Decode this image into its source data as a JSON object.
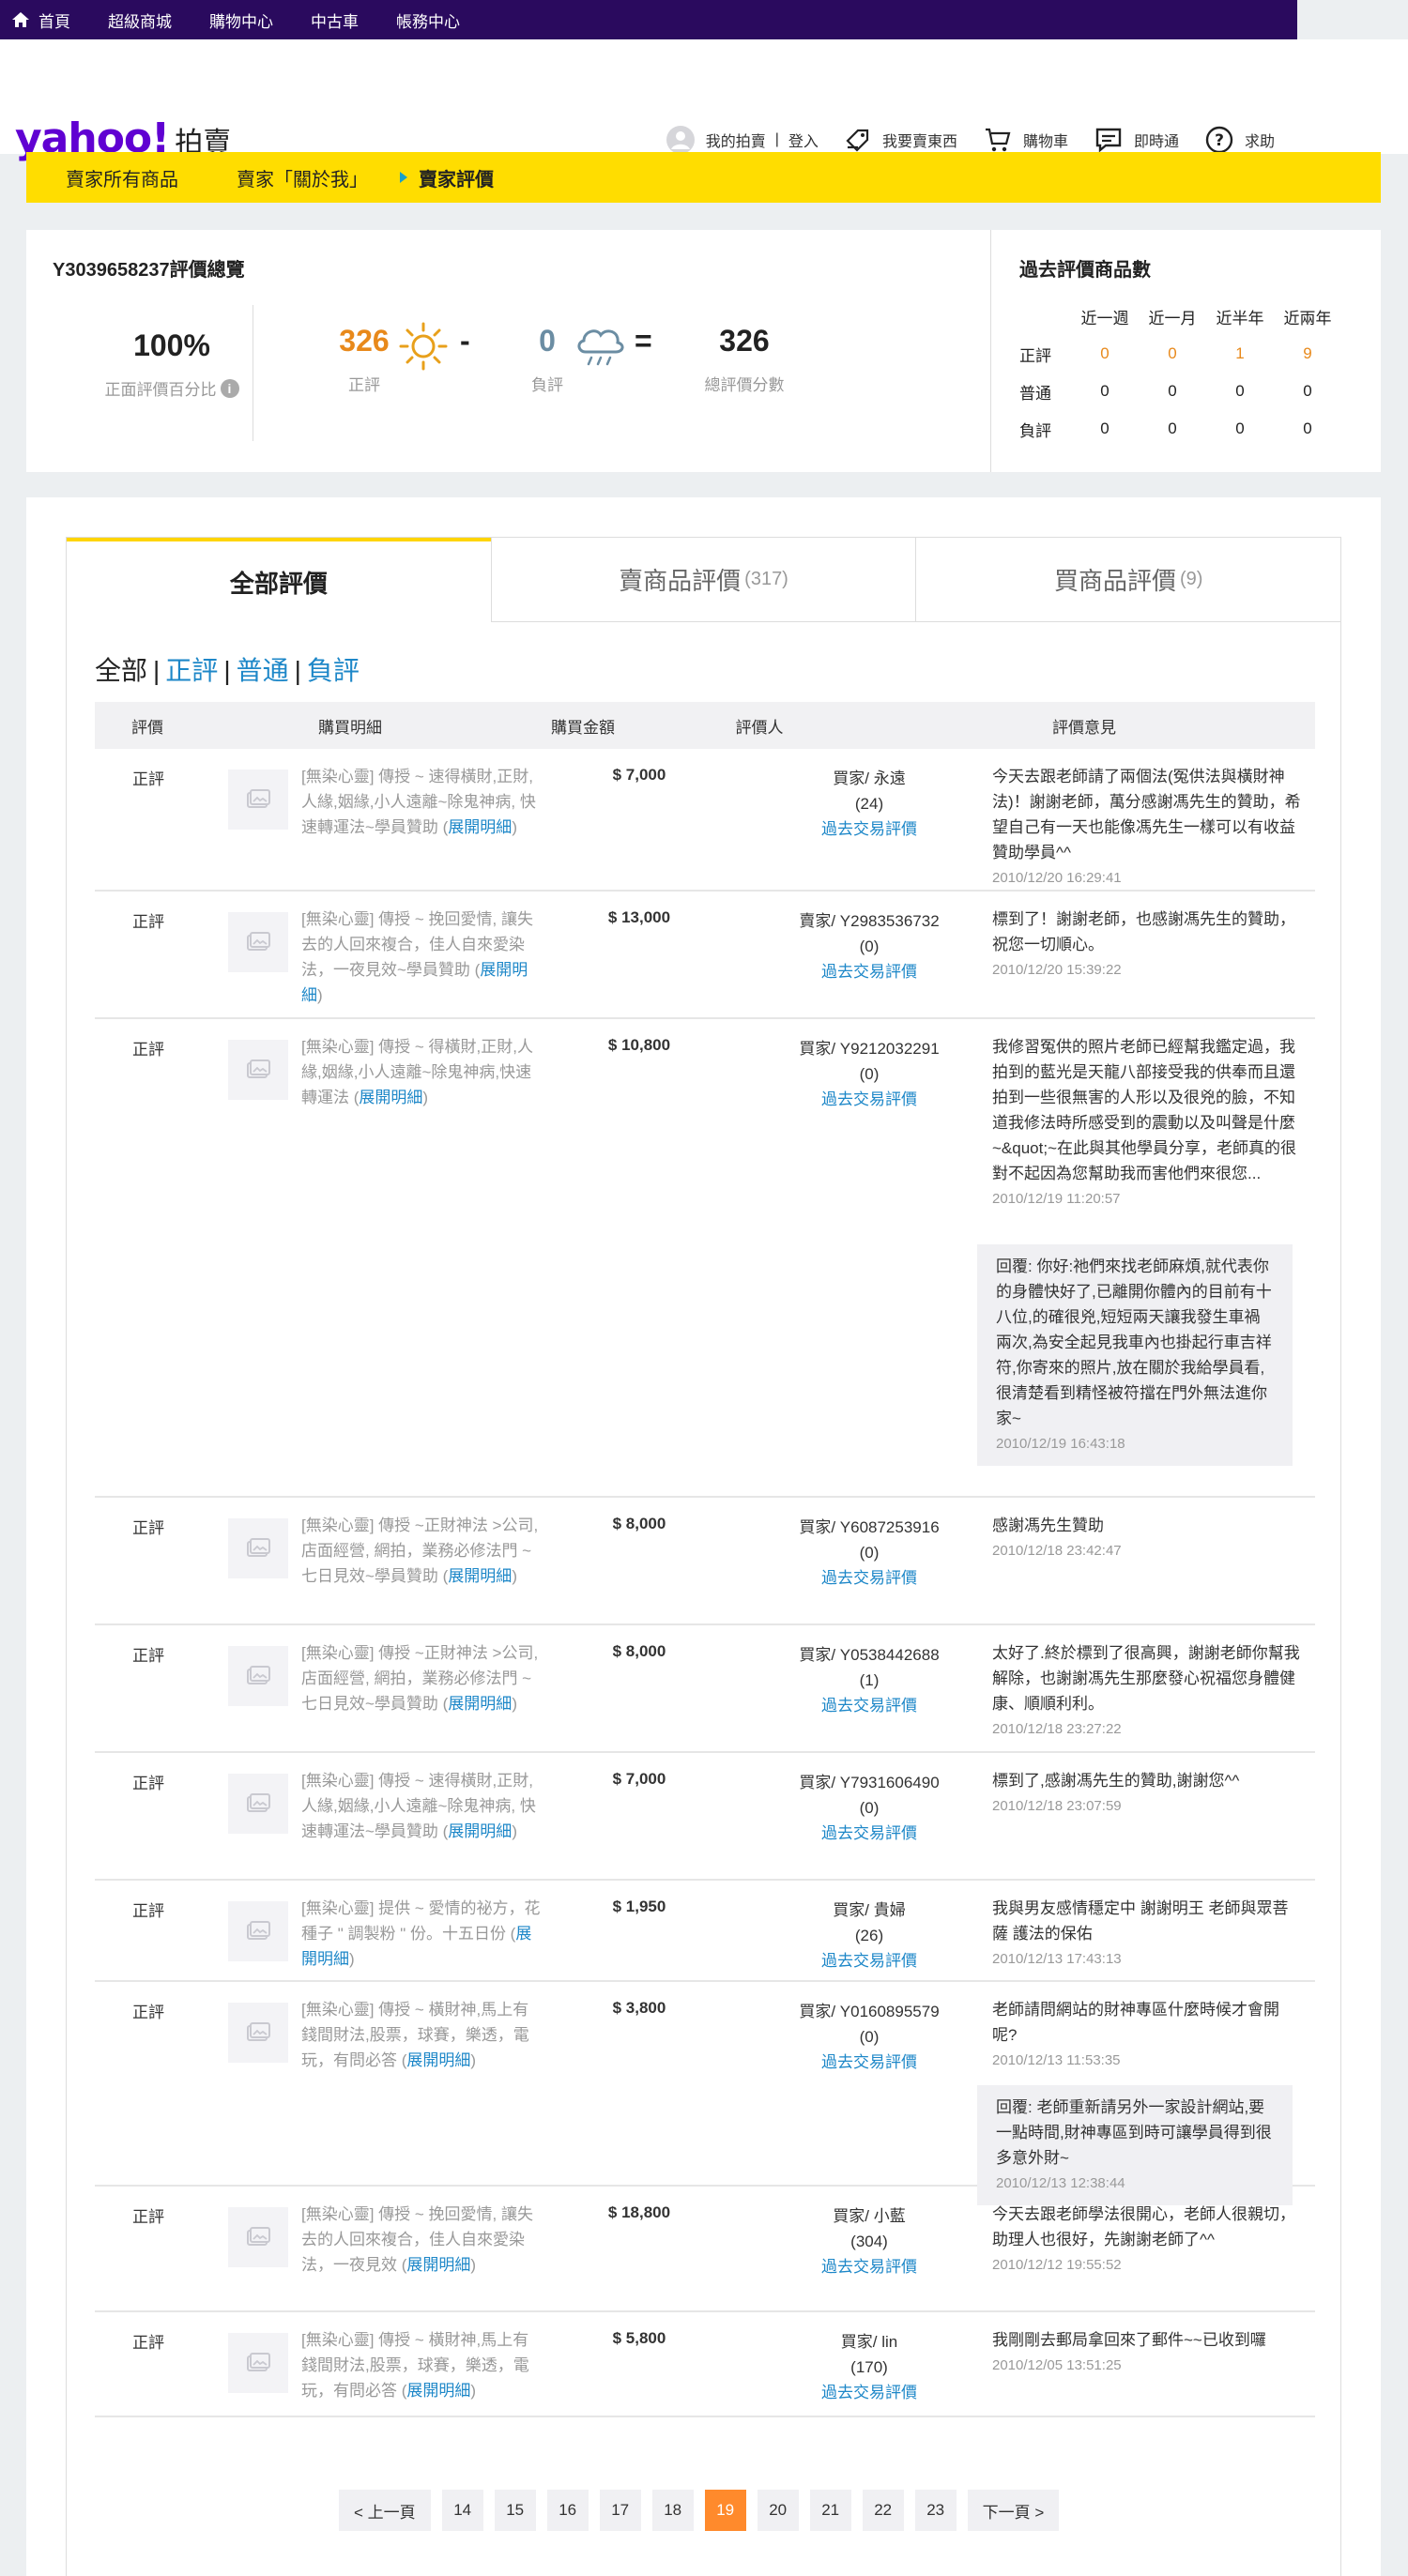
{
  "topnav": [
    "首頁",
    "超級商城",
    "購物中心",
    "中古車",
    "帳務中心"
  ],
  "logo": {
    "brand": "yahoo!",
    "sub": "拍賣"
  },
  "header_links": {
    "my": "我的拍賣",
    "login": "登入",
    "sell": "我要賣東西",
    "cart": "購物車",
    "chat": "即時通",
    "help": "求助"
  },
  "breadcrumb": {
    "all": "賣家所有商品",
    "about": "賣家「關於我」",
    "current": "賣家評價"
  },
  "summary": {
    "title": "Y3039658237評價總覽",
    "pct": "100%",
    "pct_label": "正面評價百分比",
    "pos": "326",
    "pos_label": "正評",
    "neg": "0",
    "neg_label": "負評",
    "total": "326",
    "total_label": "總評價分數",
    "minus": "-",
    "equals": "=",
    "colors": {
      "positive": "#e8891b",
      "negative": "#6b8da3"
    }
  },
  "history": {
    "title": "過去評價商品數",
    "cols": [
      "近一週",
      "近一月",
      "近半年",
      "近兩年"
    ],
    "rows": [
      {
        "label": "正評",
        "vals": [
          "0",
          "0",
          "1",
          "9"
        ]
      },
      {
        "label": "普通",
        "vals": [
          "0",
          "0",
          "0",
          "0"
        ]
      },
      {
        "label": "負評",
        "vals": [
          "0",
          "0",
          "0",
          "0"
        ]
      }
    ]
  },
  "tabs": [
    {
      "label": "全部評價",
      "count": ""
    },
    {
      "label": "賣商品評價",
      "count": "(317)"
    },
    {
      "label": "買商品評價",
      "count": "(9)"
    }
  ],
  "filter": {
    "all": "全部",
    "pos": "正評",
    "neu": "普通",
    "neg": "負評",
    "sep": "|"
  },
  "columns": [
    "評價",
    "購買明細",
    "購買金額",
    "評價人",
    "評價意見"
  ],
  "rows": [
    {
      "rate": "正評",
      "desc": "[無染心靈] 傳授 ~ 速得橫財,正財,人緣,姻緣,小人遠離~除鬼神病, 快速轉運法~學員贊助 (",
      "link": "展開明細",
      "close": ")",
      "amt": "$ 7,000",
      "buyer": "買家/ 永遠",
      "count": "(24)",
      "past": "過去交易評價",
      "comment": "今天去跟老師請了兩個法(冤供法與橫財神法)！謝謝老師，萬分感謝馮先生的贊助，希望自己有一天也能像馮先生一樣可以有收益贊助學員^^",
      "ts": "2010/12/20 16:29:41",
      "reply": "",
      "reply_ts": ""
    },
    {
      "rate": "正評",
      "desc": "[無染心靈] 傳授 ~ 挽回愛情, 讓失去的人回來複合，佳人自來愛染法，一夜見效~學員贊助 (",
      "link": "展開明細",
      "close": ")",
      "amt": "$ 13,000",
      "buyer": "賣家/ Y2983536732",
      "count": "(0)",
      "past": "過去交易評價",
      "comment": "標到了！謝謝老師，也感謝馮先生的贊助，祝您一切順心。",
      "ts": "2010/12/20 15:39:22",
      "reply": "",
      "reply_ts": ""
    },
    {
      "rate": "正評",
      "desc": "[無染心靈] 傳授 ~ 得橫財,正財,人緣,姻緣,小人遠離~除鬼神病,快速轉運法 (",
      "link": "展開明細",
      "close": ")",
      "amt": "$ 10,800",
      "buyer": "買家/ Y9212032291",
      "count": "(0)",
      "past": "過去交易評價",
      "comment": "我修習冤供的照片老師已經幫我鑑定過，我拍到的藍光是天龍八部接受我的供奉而且還拍到一些很無害的人形以及很兇的臉，不知道我修法時所感受到的震動以及叫聲是什麼~&quot;~在此與其他學員分享，老師真的很對不起因為您幫助我而害他們來很您...",
      "ts": "2010/12/19 11:20:57",
      "reply": "回覆: 你好:祂們來找老師麻煩,就代表你的身體快好了,已離開你體內的目前有十八位,的確很兇,短短兩天讓我發生車禍兩次,為安全起見我車內也掛起行車吉祥符,你寄來的照片,放在關於我給學員看,很清楚看到精怪被符擋在門外無法進你家~",
      "reply_ts": "2010/12/19 16:43:18"
    },
    {
      "rate": "正評",
      "desc": "[無染心靈] 傳授 ~正財神法 >公司, 店面經營, 網拍，業務必修法門 ~ 七日見效~學員贊助 (",
      "link": "展開明細",
      "close": ")",
      "amt": "$ 8,000",
      "buyer": "買家/ Y6087253916",
      "count": "(0)",
      "past": "過去交易評價",
      "comment": "感謝馮先生贊助",
      "ts": "2010/12/18 23:42:47",
      "reply": "",
      "reply_ts": ""
    },
    {
      "rate": "正評",
      "desc": "[無染心靈] 傳授 ~正財神法 >公司, 店面經營, 網拍，業務必修法門 ~ 七日見效~學員贊助 (",
      "link": "展開明細",
      "close": ")",
      "amt": "$ 8,000",
      "buyer": "買家/ Y0538442688",
      "count": "(1)",
      "past": "過去交易評價",
      "comment": "太好了.終於標到了很高興，謝謝老師你幫我解除，也謝謝馮先生那麼發心祝福您身體健康、順順利利。",
      "ts": "2010/12/18 23:27:22",
      "reply": "",
      "reply_ts": ""
    },
    {
      "rate": "正評",
      "desc": "[無染心靈] 傳授 ~ 速得橫財,正財,人緣,姻緣,小人遠離~除鬼神病, 快速轉運法~學員贊助 (",
      "link": "展開明細",
      "close": ")",
      "amt": "$ 7,000",
      "buyer": "買家/ Y7931606490",
      "count": "(0)",
      "past": "過去交易評價",
      "comment": "標到了,感謝馮先生的贊助,謝謝您^^",
      "ts": "2010/12/18 23:07:59",
      "reply": "",
      "reply_ts": ""
    },
    {
      "rate": "正評",
      "desc": "[無染心靈] 提供 ~ 愛情的祕方，花種子 \" 調製粉 \" 份。十五日份 (",
      "link": "展開明細",
      "close": ")",
      "amt": "$ 1,950",
      "buyer": "買家/ 貴婦",
      "count": "(26)",
      "past": "過去交易評價",
      "comment": "我與男友感情穩定中 謝謝明王 老師與眾菩薩 護法的保佑",
      "ts": "2010/12/13 17:43:13",
      "reply": "",
      "reply_ts": ""
    },
    {
      "rate": "正評",
      "desc": "[無染心靈] 傳授 ~ 橫財神,馬上有錢間財法,股票，球賽，樂透，電玩，有問必答 (",
      "link": "展開明細",
      "close": ")",
      "amt": "$ 3,800",
      "buyer": "買家/ Y0160895579",
      "count": "(0)",
      "past": "過去交易評價",
      "comment": "老師請問網站的財神專區什麼時候才會開呢?",
      "ts": "2010/12/13 11:53:35",
      "reply": "回覆: 老師重新請另外一家設計網站,要一點時間,財神專區到時可讓學員得到很多意外財~",
      "reply_ts": "2010/12/13 12:38:44"
    },
    {
      "rate": "正評",
      "desc": "[無染心靈] 傳授 ~ 挽回愛情, 讓失去的人回來複合，佳人自來愛染法，一夜見效 (",
      "link": "展開明細",
      "close": ")",
      "amt": "$ 18,800",
      "buyer": "買家/ 小藍",
      "count": "(304)",
      "past": "過去交易評價",
      "comment": "今天去跟老師學法很開心，老師人很親切，助理人也很好，先謝謝老師了^^",
      "ts": "2010/12/12 19:55:52",
      "reply": "",
      "reply_ts": ""
    },
    {
      "rate": "正評",
      "desc": "[無染心靈] 傳授 ~ 橫財神,馬上有錢間財法,股票，球賽，樂透，電玩，有問必答 (",
      "link": "展開明細",
      "close": ")",
      "amt": "$ 5,800",
      "buyer": "買家/ lin",
      "count": "(170)",
      "past": "過去交易評價",
      "comment": "我剛剛去郵局拿回來了郵件~~已收到囉",
      "ts": "2010/12/05 13:51:25",
      "reply": "",
      "reply_ts": ""
    }
  ],
  "pager": {
    "prev": "< 上一頁",
    "next": "下一頁 >",
    "pages": [
      "14",
      "15",
      "16",
      "17",
      "18",
      "19",
      "20",
      "21",
      "22",
      "23"
    ],
    "current": "19"
  }
}
